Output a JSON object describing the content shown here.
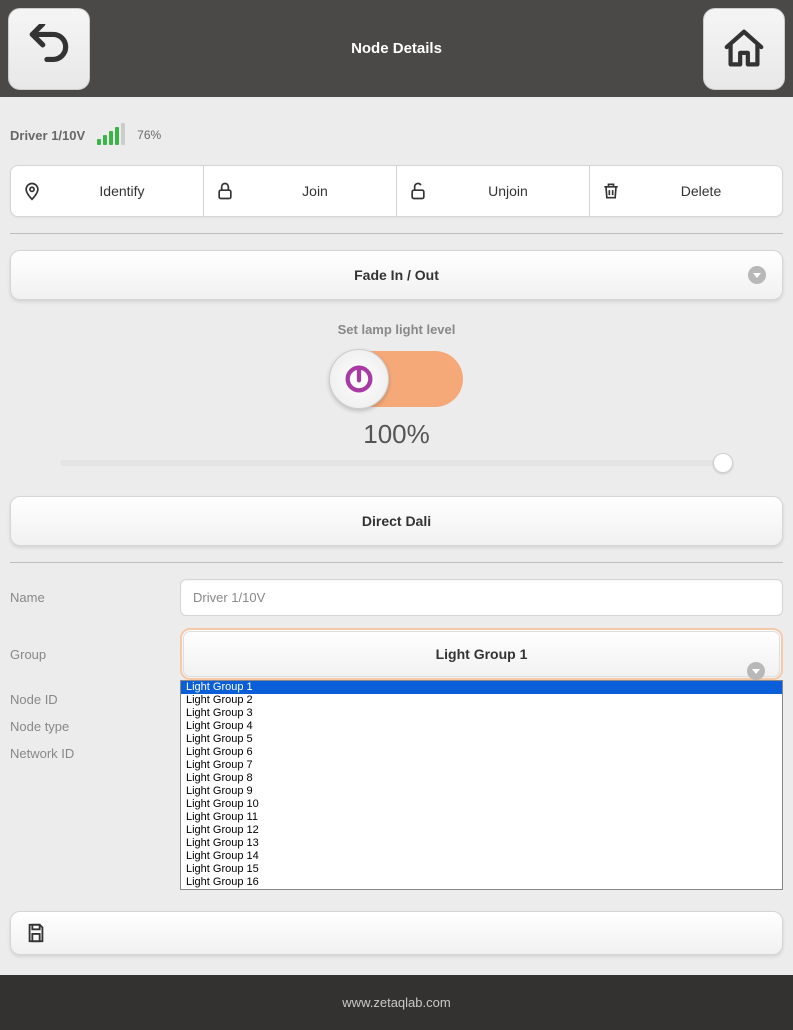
{
  "header": {
    "title": "Node Details"
  },
  "status": {
    "driver_label": "Driver 1/10V",
    "signal_pct": "76%"
  },
  "actions": {
    "identify": "Identify",
    "join": "Join",
    "unjoin": "Unjoin",
    "delete": "Delete"
  },
  "fade_section": {
    "label": "Fade In / Out"
  },
  "lamp": {
    "section_label": "Set lamp light level",
    "level": "100%"
  },
  "direct_dali": {
    "label": "Direct Dali"
  },
  "form": {
    "name_label": "Name",
    "name_value": "Driver 1/10V",
    "group_label": "Group",
    "group_selected": "Light Group 1",
    "nodeid_label": "Node ID",
    "nodetype_label": "Node type",
    "networkid_label": "Network ID"
  },
  "group_options": [
    "Light Group 1",
    "Light Group 2",
    "Light Group 3",
    "Light Group 4",
    "Light Group 5",
    "Light Group 6",
    "Light Group 7",
    "Light Group 8",
    "Light Group 9",
    "Light Group 10",
    "Light Group 11",
    "Light Group 12",
    "Light Group 13",
    "Light Group 14",
    "Light Group 15",
    "Light Group 16"
  ],
  "footer": {
    "url": "www.zetaqlab.com"
  }
}
